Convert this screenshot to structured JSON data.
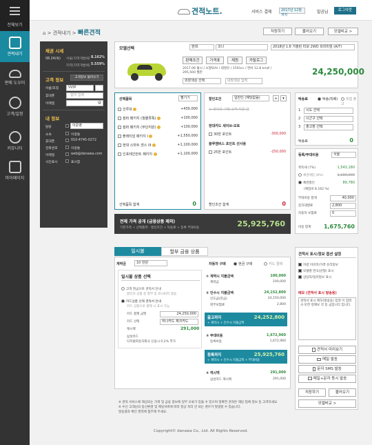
{
  "sidebar": {
    "items": [
      {
        "label": "전체보기",
        "icon": "menu-icon"
      },
      {
        "label": "견적내기",
        "icon": "clipboard-icon"
      },
      {
        "label": "판매 도우미",
        "icon": "car-icon"
      },
      {
        "label": "고객/일정",
        "icon": "people-icon"
      },
      {
        "label": "커뮤니티",
        "icon": "chat-icon"
      },
      {
        "label": "마이페이지",
        "icon": "person-icon"
      }
    ]
  },
  "header": {
    "logo": "견적노트.",
    "service_period_label": "서비스 결제",
    "service_period_value": "2017년 12월까지",
    "user": "발곰님",
    "logout": "로그아웃"
  },
  "breadcrumb": {
    "home": "⌂",
    "parent": "견적내기",
    "current": "빠른견적"
  },
  "toolbar": {
    "save": "저장하기",
    "load": "불러오기",
    "compare": "모델비교 >"
  },
  "left": {
    "rate_title": "채권 시세",
    "rate_date": "08.24(목)",
    "rate_row1_label": "서울(지역개발채)",
    "rate_row1_val": "8.162%",
    "rate_row2_label": "지역(지역개발채)",
    "rate_row2_val": "5.559%",
    "cust_title": "고객 정보",
    "cust_btn": "고객정보 불러오기",
    "cust_fields": [
      {
        "label": "이름/호칭",
        "value": "VVIP"
      },
      {
        "label": "휴대폰",
        "value": "- 없이 입력"
      },
      {
        "label": "이메일",
        "value": "@"
      }
    ],
    "my_title": "내 정보",
    "my_fields": [
      {
        "label": "담당",
        "value": "이준영"
      },
      {
        "label": "소속",
        "value": "이정통"
      },
      {
        "label": "휴대폰",
        "value": "010-4745-0272"
      },
      {
        "label": "전화번호",
        "value": "이정통"
      },
      {
        "label": "이메일",
        "value": "web@danawa.com"
      },
      {
        "label": "사진표시",
        "value": "표시함"
      }
    ]
  },
  "model": {
    "label": "모델선택",
    "brand": "현대",
    "model": "코나",
    "trim": "2018년 1.6 가솔린 터보 2WD 프리미엄 (A/T)",
    "tags": [
      "판매조건",
      "가격표",
      "제원",
      "카탈로그"
    ],
    "spec": "2017.06 출시 / 소형SUV / 휘발유 / 1591cc / 연비 12.8 km/ℓ / 295,500 월만",
    "color_ext": "외장색상 선택",
    "color_int": "내장색상 입력",
    "price": "24,250,000"
  },
  "options": {
    "title": "선택품목",
    "view": "펼기기",
    "items": [
      {
        "name": "선루프",
        "price": "+430,000"
      },
      {
        "name": "컴퍼 패키지 (월물류폭)",
        "price": "+100,000"
      },
      {
        "name": "컴퍼 패키지 (무단지원)",
        "price": "+100,000"
      },
      {
        "name": "플래티넘 패키지 I",
        "price": "+1,550,000"
      },
      {
        "name": "현대 스마트 센스 III",
        "price": "+1,100,000"
      },
      {
        "name": "인포테인먼트 패키지",
        "price": "+1,100,000"
      }
    ],
    "sum_label": "선택품목 합계",
    "sum": "0"
  },
  "discount": {
    "title": "할인조건",
    "select": "일반인 (해당없음)",
    "note": "뉴 라이프 구매 고객 지원 금",
    "card_title": "현대카드 세이브-오토",
    "card_item": "30만 포인트",
    "card_val": "-300,000",
    "blue_title": "블루멤버스 포인트 선사용",
    "blue_item": "25만 포인트",
    "blue_val": "-250,000",
    "sum_label": "할인조건 합계",
    "sum": "0"
  },
  "delivery": {
    "title": "탁송료",
    "opt1": "탁송(직배)",
    "opt2": "직접 출고",
    "rows": [
      "시도 선택",
      "시군구 선택",
      "출고장 선택"
    ],
    "label": "탁송료",
    "val": "0"
  },
  "fees": {
    "title": "등록/부대비용",
    "region": "서울",
    "r1_label": "취득세 (7%)",
    "r1_val": "1,543,180",
    "r2_label": "채권매입 (8%)",
    "r2_val": "1,190,000",
    "r3_label": "채권할인",
    "r3_val": "89,780",
    "r3_sub": "(매입비 8.162 %)",
    "extra_label": "부대비용 합계",
    "extra_val": "40,000",
    "i1": "증지대행료",
    "i1_val": "2,800",
    "i2": "자동차 보험료",
    "i2_val": "0",
    "sum_label": "비용 합계",
    "sum": "1,675,760"
  },
  "total": {
    "title": "전체 가격 공개 (금융상품 제외)",
    "sub": "기본가격 + 선택품목 - 할인조건 + 탁송료 + 등록 부대비용",
    "value": "25,925,760"
  },
  "tabs": {
    "t1": "일시불",
    "t2": "할부 금융 상품"
  },
  "payment": {
    "price_label": "계약금",
    "price_select": "10 만원",
    "choice_label": "자동차 구매",
    "cash": "현금 구매",
    "card": "카드 결제",
    "title": "일시불 상품 선택",
    "method1": "고객 현금으로 견적서 안내",
    "method1_sub": "할인의 상품 중 할부 등 표시되지 않음",
    "method2": "카드상품 선택 견적서 안내",
    "method2_sub": "카드 상품으로 결제 시 표시 가능",
    "pay_amount_label": "카드 결제 금액",
    "pay_amount": "24,250,000",
    "card_select_label": "카드 선택",
    "card_select": "하나카드 체크카드",
    "cashback_label": "캐시백",
    "cashback": "291,000",
    "cashback_sub1": "삼성카드",
    "cashback_sub2": "디지털자동차회사 신용시 0.2% 추가",
    "s1": "① 계약시 지불금액",
    "s1v": "100,000",
    "s1a": "계약금",
    "s1av": "100,000",
    "s2": "② 인수시 지불금액",
    "s2v": "24,152,800",
    "s2a": "인도금(잔금)",
    "s2av": "24,150,000",
    "s2b": "외부보험료",
    "s2bv": "2,800",
    "s3": "출고까지",
    "s3v": "24,252,800",
    "s3a": "+ 계약시 + 인수시 지불금액",
    "s4": "③ 부대비용",
    "s4v": "1,672,960",
    "s4a": "등록비용",
    "s4av": "1,672,960",
    "s5": "등록까지",
    "s5v": "25,925,760",
    "s5a": "+ 계약시 + 인수시 지불금액 + 부대비용",
    "s6": "④ 캐시백",
    "s6v": "291,000",
    "s6a": "삼성카드 캐시백",
    "s6av": "291,000"
  },
  "settings": {
    "title": "견적서 표시/정보 옵션 설정",
    "o1": "차량 이미지/가격 숏리빙보",
    "o2": "모델명 연식(년형) 표시",
    "o3": "상담자/딜러정보 표시",
    "memo_title": "메모 (견적서 표시 발송용)",
    "memo": "견적서 표시 메모(발송용) 입력 이 입력사 또한 정해보 각 등 금입니다 입니다.",
    "b1": "견적서 미리보기",
    "b2": "메일 발송",
    "b3": "문자 SMS 발송",
    "b4": "메일+문자 동시 발송",
    "save": "저장하기",
    "load": "불러오기",
    "compare": "모델비교 >"
  },
  "notes": [
    "※ 견적 서비스에 제공되는 가격 및 금융 정보에 일부 오류가 있을 수 있으며 정확한 견적은 해당 업체 정보 등 고려하세요.",
    "※ 수신 고객님의 동신환경 및 메일서버에 따라 정상 처리 안 되는 경우가 발생할 수 있습니다.",
    "발송결과 확인 영역에 첨부해 주세요."
  ],
  "footer": "Copyright© danawa Co., Ltd. All Rights Reserved."
}
